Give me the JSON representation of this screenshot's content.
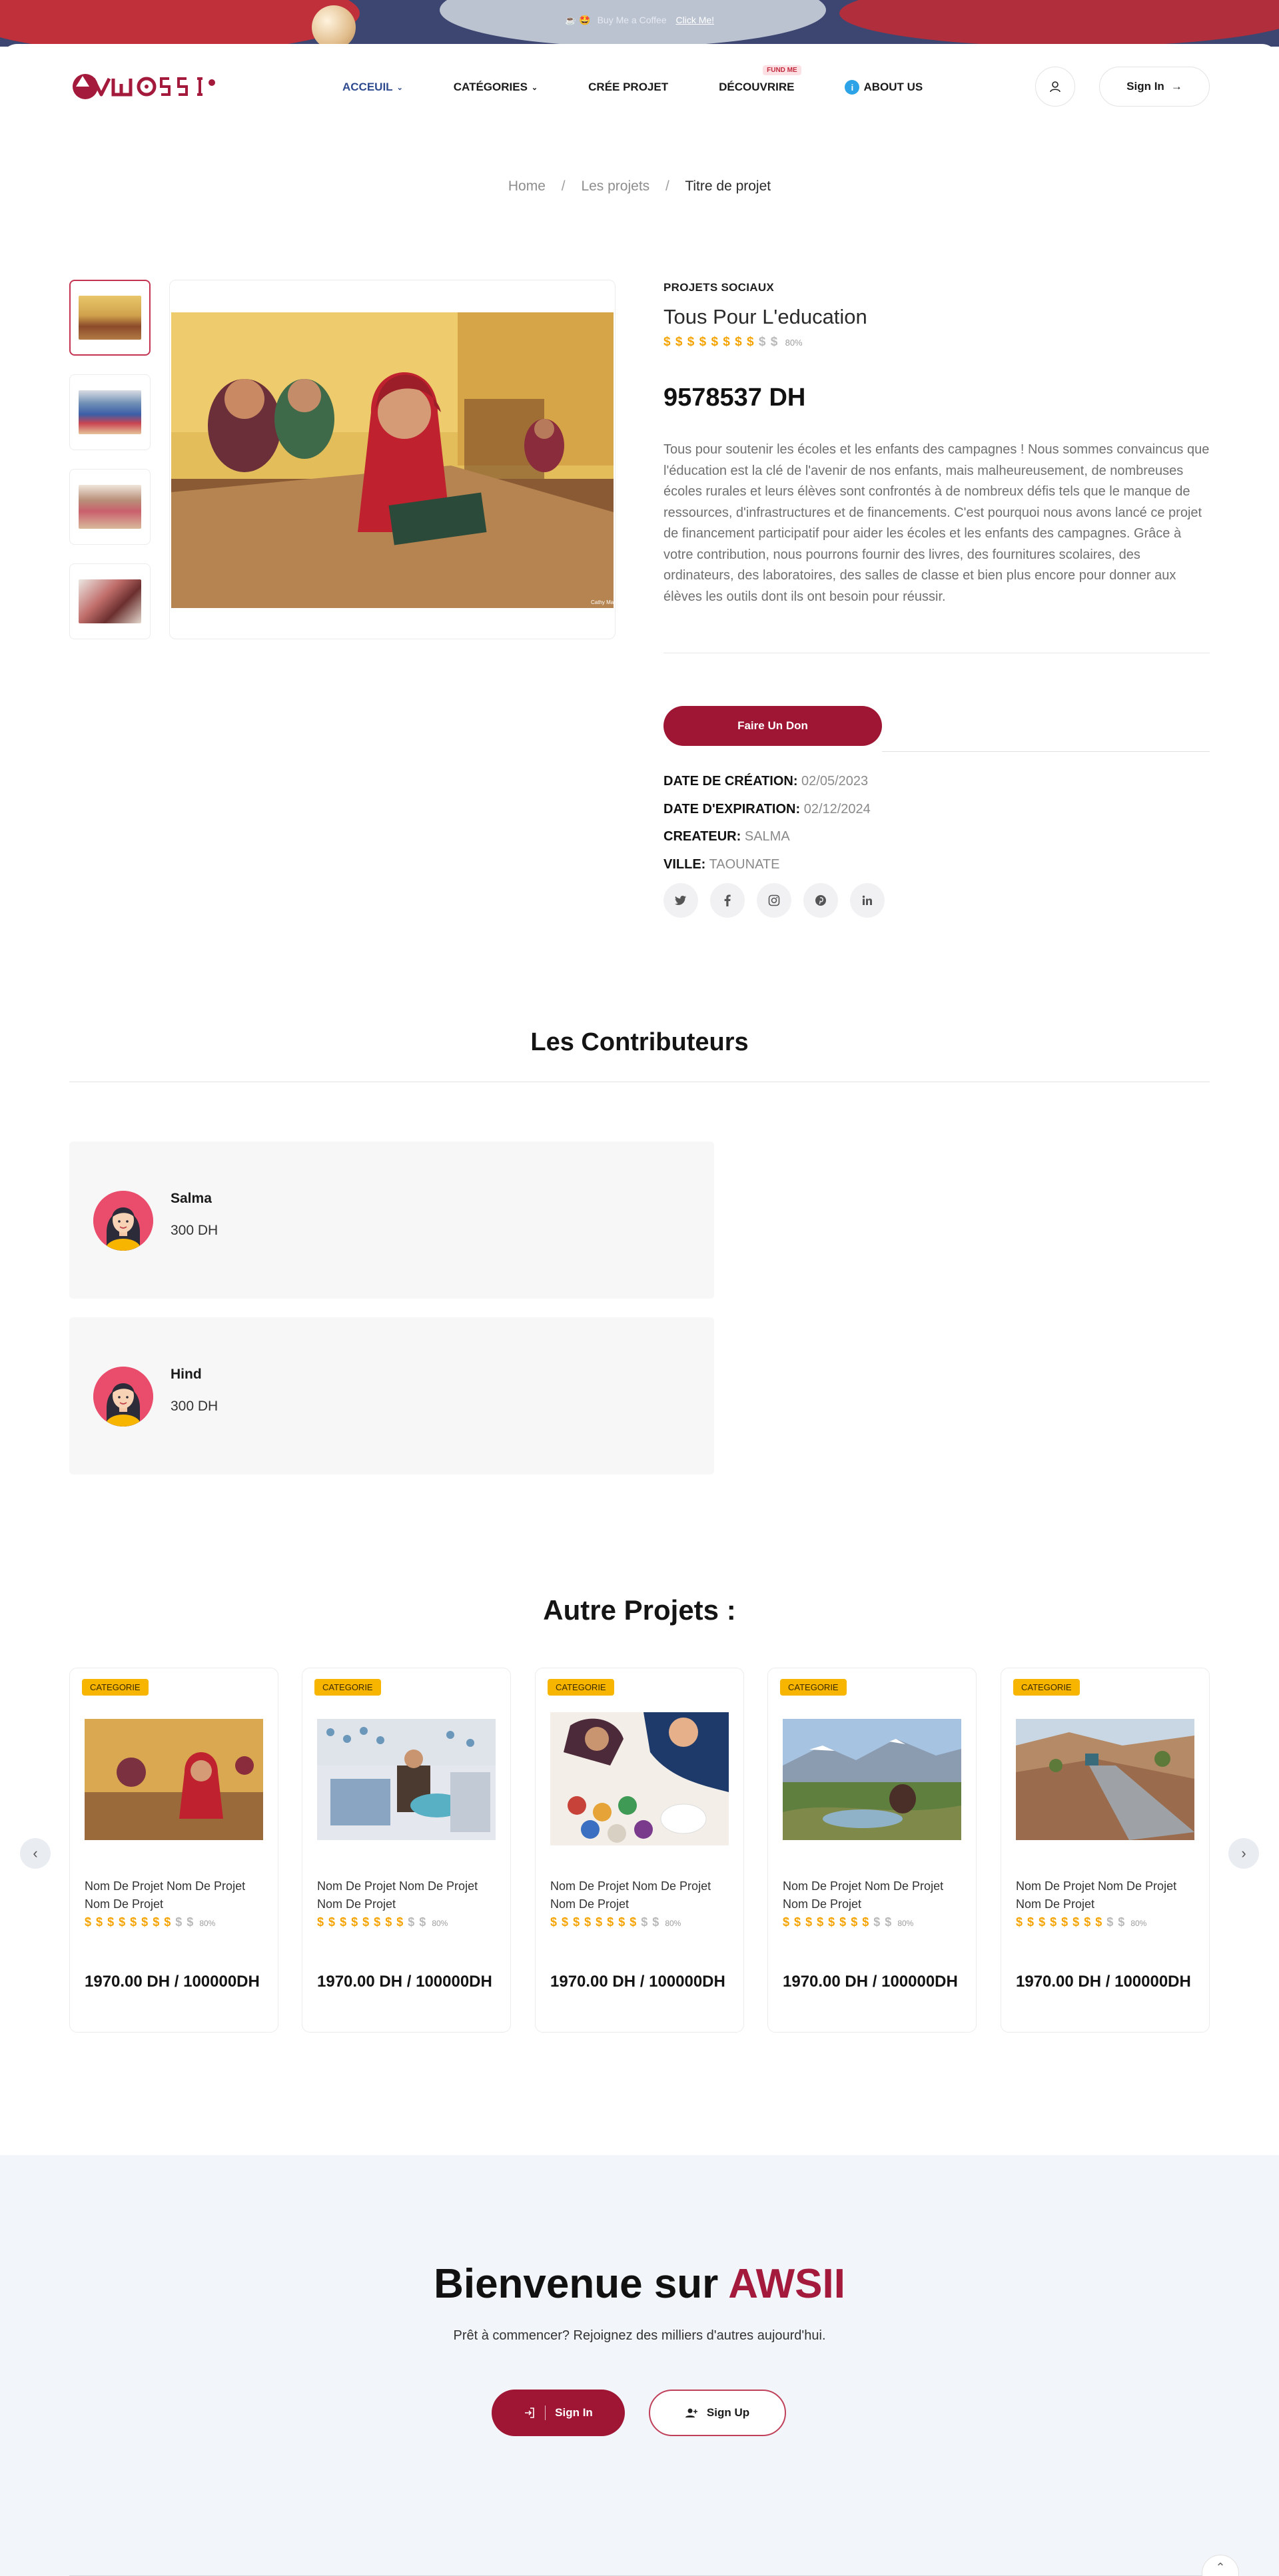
{
  "promo": {
    "emoji": "☕ 🤩",
    "text": "Buy Me a Coffee",
    "link": "Click Me!"
  },
  "header": {
    "logo_text": "AWSII",
    "nav": [
      {
        "label": "ACCEUIL",
        "active": true,
        "dropdown": true
      },
      {
        "label": "CATÉGORIES",
        "active": false,
        "dropdown": true
      },
      {
        "label": "CRÉE PROJET",
        "active": false,
        "dropdown": false
      },
      {
        "label": "DÉCOUVRIRE",
        "active": false,
        "dropdown": false,
        "badge": "FUND ME"
      },
      {
        "label": "ABOUT US",
        "active": false,
        "dropdown": false,
        "icon": "info-icon"
      }
    ],
    "signin_label": "Sign In",
    "user_icon": "user-icon"
  },
  "breadcrumb": [
    "Home",
    "Les projets",
    "Titre de projet"
  ],
  "project": {
    "category": "PROJETS SOCIAUX",
    "title": "Tous Pour L'education",
    "rating": {
      "filled": 8,
      "total": 10,
      "percent": "80%"
    },
    "amount": "9578537 DH",
    "description": "Tous pour soutenir les écoles et les enfants des campagnes ! Nous sommes convaincus que l'éducation est la clé de l'avenir de nos enfants, mais malheureusement, de nombreuses écoles rurales et leurs élèves sont confrontés à de nombreux défis tels que le manque de ressources, d'infrastructures et de financements. C'est pourquoi nous avons lancé ce projet de financement participatif pour aider les écoles et les enfants des campagnes. Grâce à votre contribution, nous pourrons fournir des livres, des fournitures scolaires, des ordinateurs, des laboratoires, des salles de classe et bien plus encore pour donner aux élèves les outils dont ils ont besoin pour réussir.",
    "donate_label": "Faire Un Don",
    "meta": [
      {
        "label": "DATE DE CRÉATION:",
        "value": "02/05/2023"
      },
      {
        "label": "DATE D'EXPIRATION:",
        "value": "02/12/2024"
      },
      {
        "label": "CREATEUR:",
        "value": "SALMA"
      },
      {
        "label": "VILLE:",
        "value": "TAOUNATE"
      }
    ],
    "socials": [
      "twitter-icon",
      "facebook-icon",
      "instagram-icon",
      "pinterest-icon",
      "linkedin-icon"
    ],
    "image_credit": "Cathy Magee"
  },
  "contributors": {
    "title": "Les Contributeurs",
    "items": [
      {
        "name": "Salma",
        "amount": "300 DH"
      },
      {
        "name": "Hind",
        "amount": "300 DH"
      }
    ]
  },
  "others": {
    "title": "Autre Projets :",
    "cards": [
      {
        "category": "CATEGORIE",
        "name": "Nom De Projet Nom De Projet Nom De Projet",
        "rating_percent": "80%",
        "price": "1970.00 DH / 100000DH"
      },
      {
        "category": "CATEGORIE",
        "name": "Nom De Projet Nom De Projet Nom De Projet",
        "rating_percent": "80%",
        "price": "1970.00 DH / 100000DH"
      },
      {
        "category": "CATEGORIE",
        "name": "Nom De Projet Nom De Projet Nom De Projet",
        "rating_percent": "80%",
        "price": "1970.00 DH / 100000DH"
      },
      {
        "category": "CATEGORIE",
        "name": "Nom De Projet Nom De Projet Nom De Projet",
        "rating_percent": "80%",
        "price": "1970.00 DH / 100000DH"
      },
      {
        "category": "CATEGORIE",
        "name": "Nom De Projet Nom De Projet Nom De Projet",
        "rating_percent": "80%",
        "price": "1970.00 DH / 100000DH"
      }
    ]
  },
  "cta": {
    "title_prefix": "Bienvenue sur",
    "title_brand": "AWSII",
    "subtitle": "Prêt à commencer? Rejoignez des milliers d'autres aujourd'hui.",
    "signin_label": "Sign In",
    "signup_label": "Sign Up"
  },
  "colors": {
    "brand": "#9f1534",
    "nav_active": "#2f4b8f",
    "star": "#f5a300",
    "badge": "#f7b500"
  }
}
